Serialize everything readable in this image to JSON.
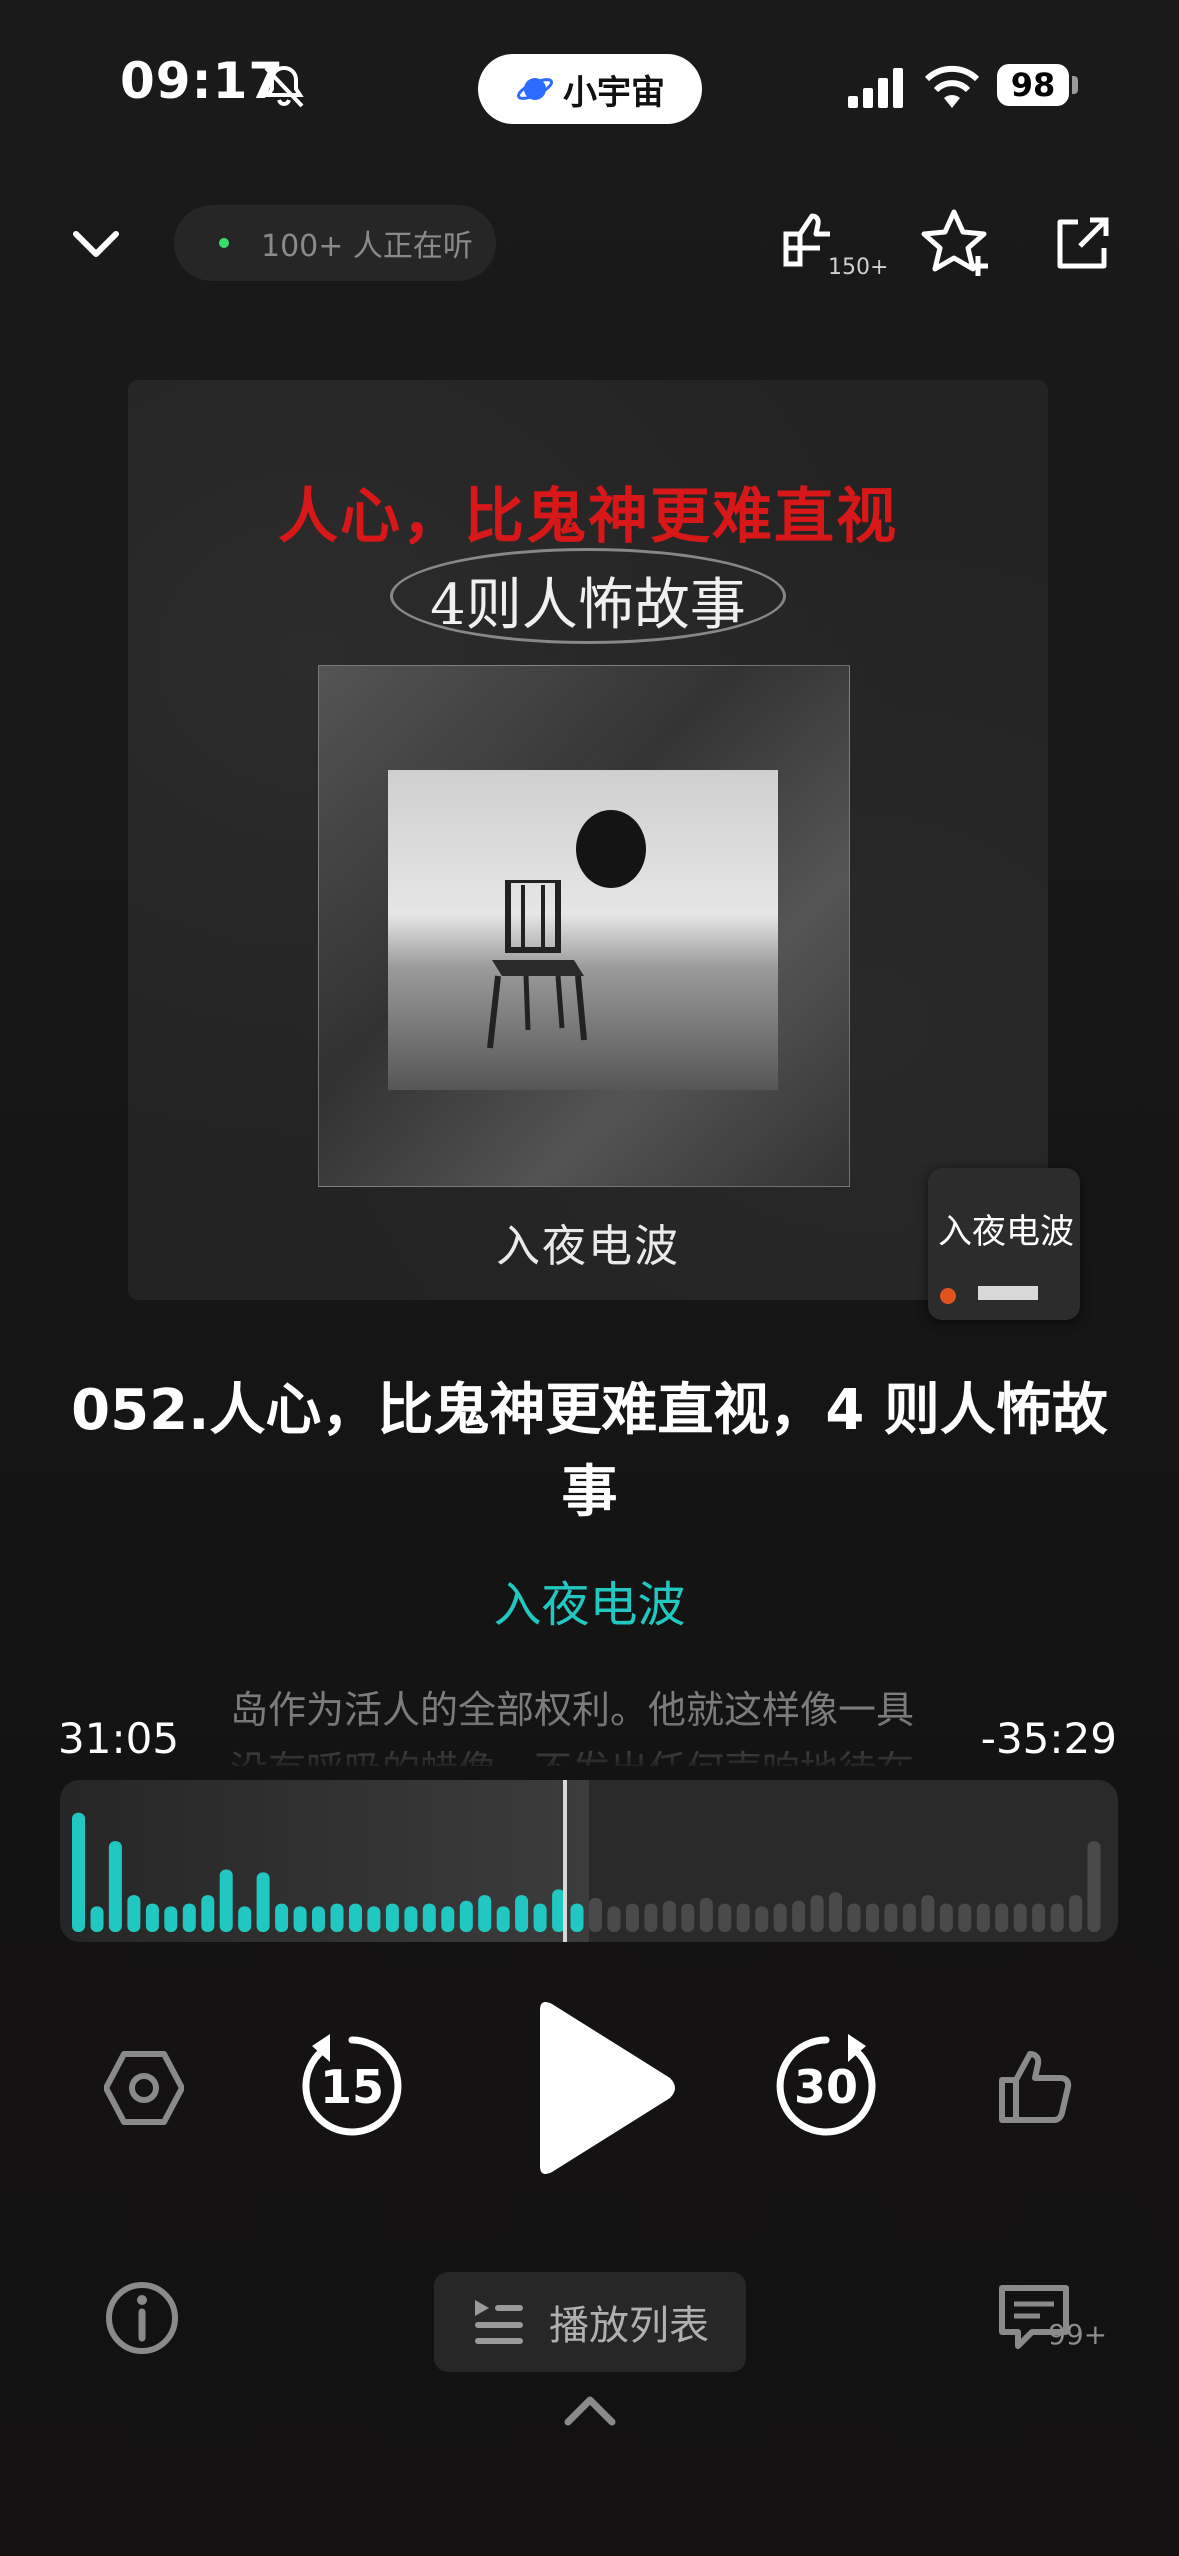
{
  "status_bar": {
    "time": "09:17",
    "app_pill": "小宇宙",
    "battery": "98"
  },
  "top_bar": {
    "listeners": "100+ 人正在听",
    "share_count": "150+"
  },
  "cover": {
    "headline": "人心，比鬼神更难直视",
    "subhead": "4则人怖故事",
    "brand": "入夜电波",
    "badge_text": "入夜电波"
  },
  "episode": {
    "title": "052.人心，比鬼神更难直视，4 则人怖故事",
    "podcast": "入夜电波"
  },
  "transcript": {
    "line1": "岛作为活人的全部权利。他就这样像一具",
    "line2": "没有呼吸的蜡像，不发出任何声响地待在"
  },
  "player": {
    "elapsed": "31:05",
    "remaining": "-35:29",
    "skip_back": "15",
    "skip_forward": "30",
    "progress": 0.5,
    "accent_color": "#21c8c2"
  },
  "bottom_bar": {
    "playlist_label": "播放列表",
    "comment_count": "99+"
  },
  "icons": [
    "bell-slash-icon",
    "planet-icon",
    "signal-icon",
    "wifi-icon",
    "chevron-down-icon",
    "share-count-icon",
    "star-add-icon",
    "share-out-icon",
    "hexagon-gear-icon",
    "skip-back-15-icon",
    "play-icon",
    "skip-forward-30-icon",
    "thumb-up-icon",
    "info-icon",
    "playlist-icon",
    "comment-icon",
    "chevron-up-icon"
  ]
}
